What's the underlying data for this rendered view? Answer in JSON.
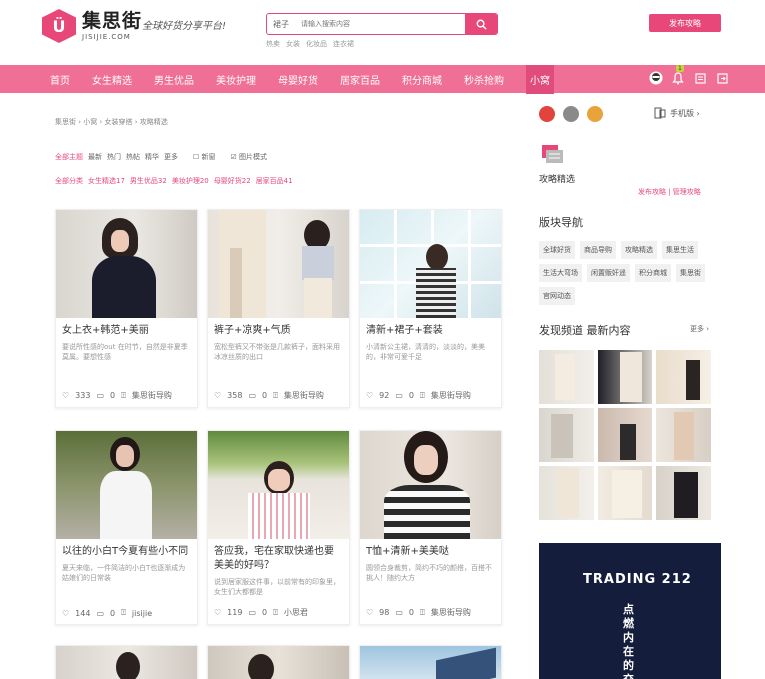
{
  "header": {
    "logo_mark": "Ü",
    "logo_cn": "集思街",
    "logo_en": "JISIJIE.COM",
    "slogan": "全球好货分享平台!",
    "search_category": "裙子",
    "search_placeholder": "请输入搜索内容",
    "hot_words": [
      "热卖",
      "女装",
      "化妆品",
      "连衣裙"
    ],
    "login_button": "发布攻略"
  },
  "nav": {
    "items": [
      "首页",
      "女生精选",
      "男生优品",
      "美妆护理",
      "母婴好货",
      "居家百品",
      "积分商城",
      "秒杀抢购",
      "小窝"
    ],
    "active_index": 8,
    "badge": "1"
  },
  "breadcrumb": "集思街 › 小窝 › 女装穿搭 › 攻略精选",
  "filters": {
    "row1": [
      "全部主题",
      "最新",
      "热门",
      "热帖",
      "精华",
      "更多"
    ],
    "check_new": "新窗",
    "check_img": "图片模式",
    "row2": [
      "全部分类",
      "女生精选17",
      "男生优品32",
      "美妆护理20",
      "母婴好货22",
      "居家百品41"
    ]
  },
  "cards": [
    {
      "title": "女上衣+韩范+美丽",
      "desc": "要说所性感的out 在时节，自然是非夏季莫属。要想性感",
      "likes": "333",
      "comments": "0",
      "author": "集思街导购"
    },
    {
      "title": "裤子+凉爽+气质",
      "desc": "宽松型裤又不带张是几款裤子，面料采用冰凉丝质的出口",
      "likes": "358",
      "comments": "0",
      "author": "集思街导购"
    },
    {
      "title": "清新+裙子+套装",
      "desc": "小清新公主裙，清清的，淡淡的，美美的，非常可爱千足",
      "likes": "92",
      "comments": "0",
      "author": "集思街导购"
    },
    {
      "title": "以往的小白T今夏有些小不同",
      "desc": "夏天来临，一件简洁的小白T也逐渐成为姑娘们的日常装",
      "likes": "144",
      "comments": "0",
      "author": "jisijie"
    },
    {
      "title": "答应我，宅在家取快递也要美美的好吗？",
      "desc": "说到居家服这件事，以前常有的印象里，女生们大都都是",
      "likes": "119",
      "comments": "0",
      "author": "小思君"
    },
    {
      "title": "T恤+清新+美美哒",
      "desc": "圆领合身裁剪，简约不巧的颜搭，百搭不挑人！随约大方",
      "likes": "98",
      "comments": "0",
      "author": "集思街导购"
    }
  ],
  "sidebar": {
    "mobile_label": "手机版 ›",
    "guide_title": "攻略精选",
    "guide_links": "发布攻略 | 管理攻略",
    "board_title": "版块导航",
    "tags": [
      "全球好货",
      "商品导购",
      "攻略精选",
      "集思生活",
      "生活大弯场",
      "闲置贩奸遥",
      "积分商城",
      "集思街",
      "官网动态"
    ],
    "latest_title": "发现频道 最新内容",
    "more": "更多 ›",
    "ad_title": "TRADING 212",
    "ad_text": "点燃内在的交"
  },
  "colors": {
    "accent": "#e8477a",
    "nav_bg": "#ef6f97",
    "ad_bg": "#141d3c"
  }
}
